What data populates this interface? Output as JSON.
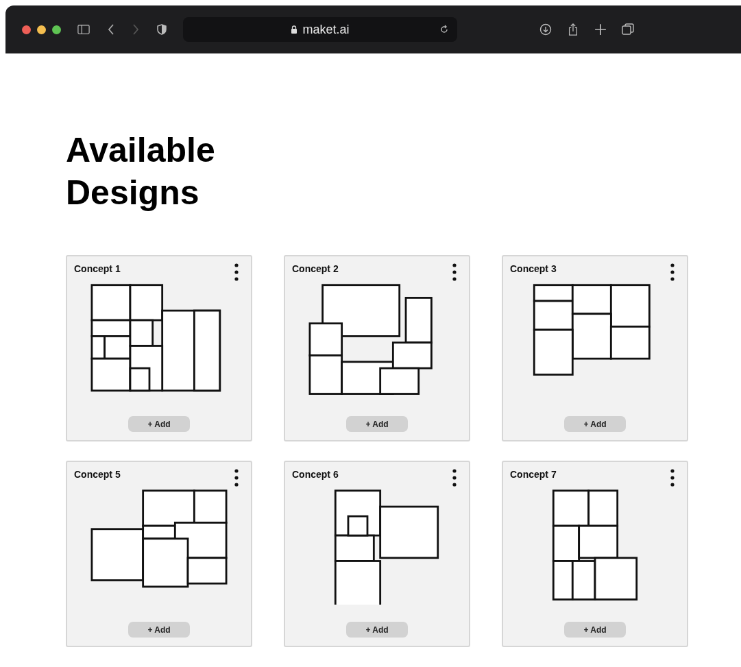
{
  "browser": {
    "url": "maket.ai"
  },
  "heading": "Available Designs",
  "cards": [
    {
      "title": "Concept 1",
      "button": "+ Add"
    },
    {
      "title": "Concept 2",
      "button": "+ Add"
    },
    {
      "title": "Concept 3",
      "button": "+ Add"
    },
    {
      "title": "Concept 5",
      "button": "+ Add"
    },
    {
      "title": "Concept 6",
      "button": "+ Add"
    },
    {
      "title": "Concept 7",
      "button": "+ Add"
    }
  ]
}
